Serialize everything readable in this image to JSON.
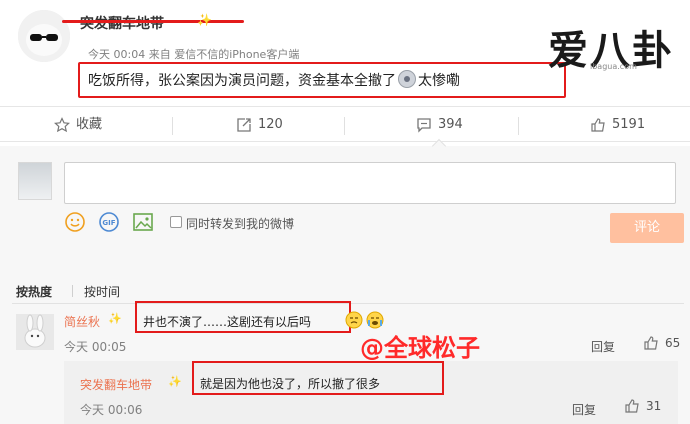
{
  "post": {
    "author": "突发翻车地带",
    "badge": "✨",
    "meta": "今天 00:04 来自 爱信不信的iPhone客户端",
    "text_before_emoji": "吃饭所得，张公案因为演员问题，资金基本全撤了",
    "text_after_emoji": "太惨嘞"
  },
  "logo": {
    "text": "爱八卦",
    "sub": "ibagua.com"
  },
  "actions": {
    "favorite_label": "收藏",
    "forward_count": "120",
    "comment_count": "394",
    "like_count": "5191"
  },
  "composer": {
    "forward_label": "同时转发到我的微博",
    "submit_label": "评论"
  },
  "sort": {
    "hot": "按热度",
    "time": "按时间"
  },
  "comments": [
    {
      "author": "简丝秋",
      "badge": "✨",
      "text": "井也不演了……这剧还有以后吗",
      "time": "今天 00:05",
      "reply_label": "回复",
      "likes": "65"
    }
  ],
  "reply": {
    "author": "突发翻车地带",
    "badge": "✨",
    "text": "就是因为他也没了，所以撤了很多",
    "time": "今天 00:06",
    "reply_label": "回复",
    "likes": "31"
  },
  "watermark": "@全球松子",
  "colors": {
    "accent": "#eb7350",
    "highlight": "#e31b1b",
    "submit": "#ffc09f"
  }
}
